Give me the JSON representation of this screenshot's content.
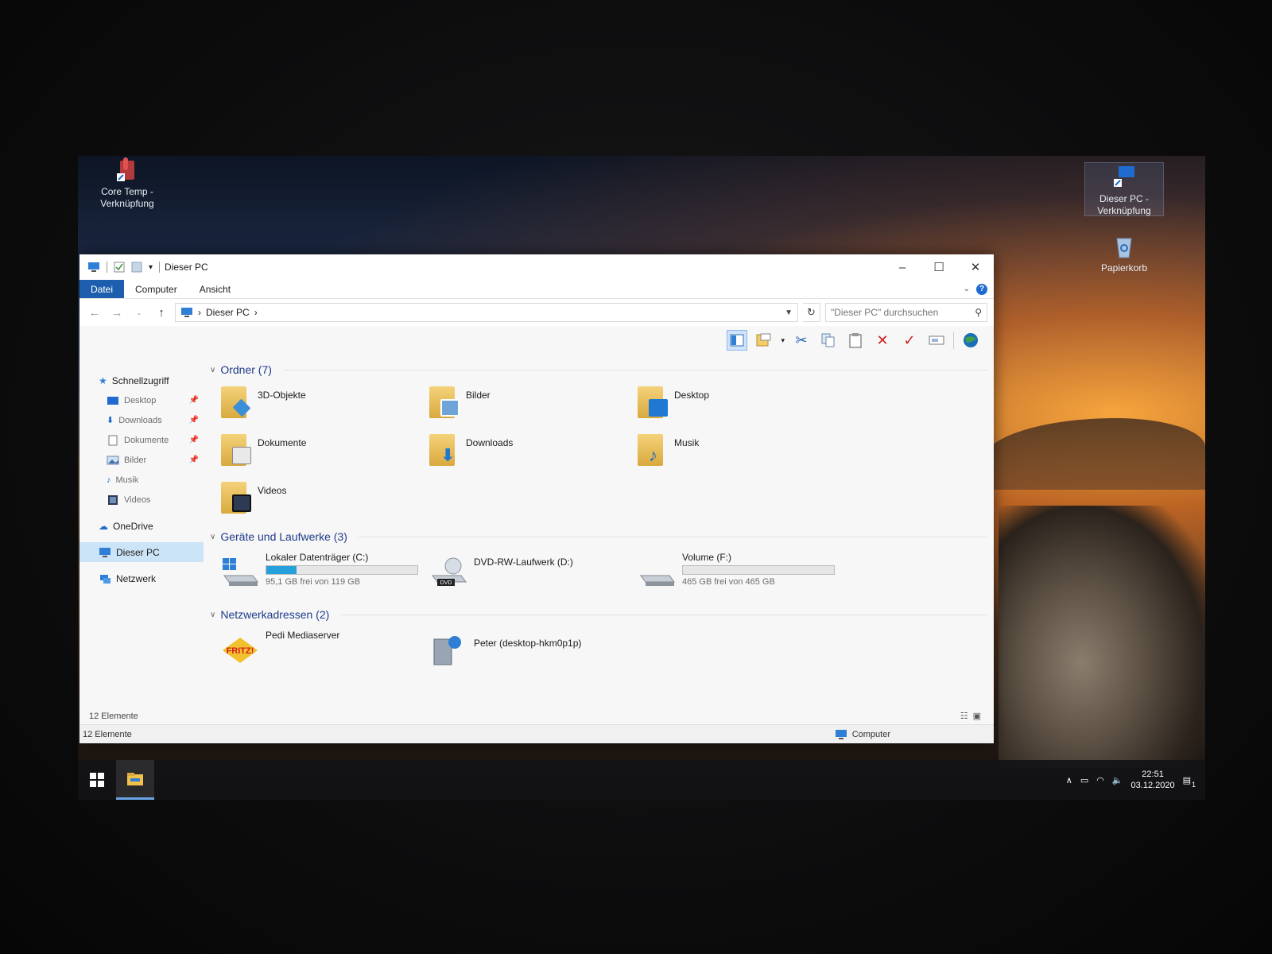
{
  "desktop": {
    "icons": [
      {
        "label": "Core Temp - Verknüpfung"
      },
      {
        "label": "Dieser PC - Verknüpfung"
      },
      {
        "label": "Papierkorb"
      }
    ]
  },
  "window": {
    "title": "Dieser PC",
    "ribbon_tabs": [
      "Datei",
      "Computer",
      "Ansicht"
    ],
    "address": {
      "path": [
        "Dieser PC"
      ]
    },
    "search": {
      "placeholder": "\"Dieser PC\" durchsuchen"
    },
    "toolbar": [
      "preview-pane",
      "properties",
      "cut",
      "copy",
      "paste",
      "delete",
      "confirm",
      "rename",
      "globe"
    ]
  },
  "nav": {
    "items": [
      {
        "label": "Schnellzugriff",
        "icon": "star-icon",
        "pinned": false
      },
      {
        "label": "Desktop",
        "icon": "desktop-icon",
        "pinned": true
      },
      {
        "label": "Downloads",
        "icon": "download-icon",
        "pinned": true
      },
      {
        "label": "Dokumente",
        "icon": "document-icon",
        "pinned": true
      },
      {
        "label": "Bilder",
        "icon": "picture-icon",
        "pinned": true
      },
      {
        "label": "Musik",
        "icon": "music-icon",
        "pinned": false
      },
      {
        "label": "Videos",
        "icon": "video-icon",
        "pinned": false
      },
      {
        "label": "OneDrive",
        "icon": "cloud-icon",
        "pinned": false
      },
      {
        "label": "Dieser PC",
        "icon": "computer-icon",
        "pinned": false,
        "selected": true
      },
      {
        "label": "Netzwerk",
        "icon": "network-icon",
        "pinned": false
      }
    ],
    "count": "12 Elemente"
  },
  "groups": {
    "folders": {
      "title": "Ordner (7)",
      "items": [
        {
          "label": "3D-Objekte",
          "badge": "#3a8fd8"
        },
        {
          "label": "Bilder",
          "badge": "#6fa4d8"
        },
        {
          "label": "Desktop",
          "badge": "#1f78d1"
        },
        {
          "label": "Dokumente",
          "badge": "#e9e9e9"
        },
        {
          "label": "Downloads",
          "badge": "#1f78d1"
        },
        {
          "label": "Musik",
          "badge": "#2b6fbf"
        },
        {
          "label": "Videos",
          "badge": "#2d3a54"
        }
      ]
    },
    "drives": {
      "title": "Geräte und Laufwerke (3)",
      "items": [
        {
          "label": "Lokaler Datenträger (C:)",
          "space": "95,1 GB frei von 119 GB",
          "used_fraction": 0.2
        },
        {
          "label": "DVD-RW-Laufwerk (D:)"
        },
        {
          "label": "Volume (F:)",
          "space": "465 GB frei von 465 GB",
          "used_fraction": 0.0
        }
      ]
    },
    "network": {
      "title": "Netzwerkadressen (2)",
      "items": [
        {
          "label": "Pedi Mediaserver",
          "badge_text": "FRITZ!"
        },
        {
          "label": "Peter (desktop-hkm0p1p)"
        }
      ]
    }
  },
  "status": {
    "count": "12 Elemente",
    "zone": "Computer"
  },
  "taskbar": {
    "time": "22:51",
    "date": "03.12.2020",
    "notif_count": "1"
  }
}
